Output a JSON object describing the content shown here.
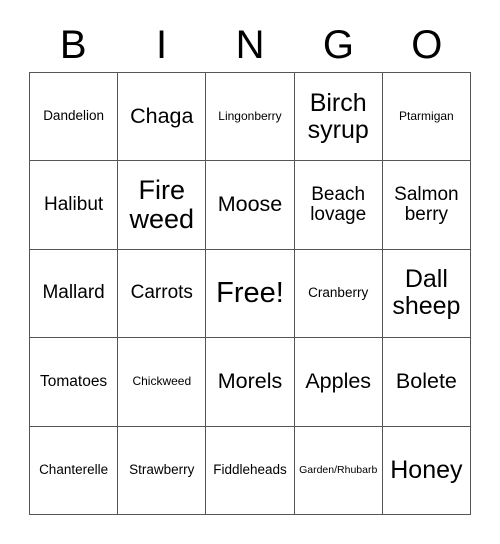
{
  "card": {
    "title": "BINGO",
    "header_letters": [
      "B",
      "I",
      "N",
      "G",
      "O"
    ],
    "grid_size": "5x5",
    "colors": {
      "background": "#ffffff",
      "text": "#000000",
      "grid_line": "#555555"
    },
    "rows": [
      [
        {
          "label": "Dandelion",
          "size": "sz-s"
        },
        {
          "label": "Chaga",
          "size": "sz-xl"
        },
        {
          "label": "Lingonberry",
          "size": "sz-xs"
        },
        {
          "label": "Birch syrup",
          "size": "sz-xxl"
        },
        {
          "label": "Ptarmigan",
          "size": "sz-xs"
        }
      ],
      [
        {
          "label": "Halibut",
          "size": "sz-l"
        },
        {
          "label": "Fire weed",
          "size": "sz-3xl"
        },
        {
          "label": "Moose",
          "size": "sz-xl"
        },
        {
          "label": "Beach lovage",
          "size": "sz-l"
        },
        {
          "label": "Salmon berry",
          "size": "sz-l"
        }
      ],
      [
        {
          "label": "Mallard",
          "size": "sz-l"
        },
        {
          "label": "Carrots",
          "size": "sz-l"
        },
        {
          "label": "Free!",
          "size": "sz-4xl"
        },
        {
          "label": "Cranberry",
          "size": "sz-s"
        },
        {
          "label": "Dall sheep",
          "size": "sz-xxl"
        }
      ],
      [
        {
          "label": "Tomatoes",
          "size": "sz-m"
        },
        {
          "label": "Chickweed",
          "size": "sz-xs"
        },
        {
          "label": "Morels",
          "size": "sz-xl"
        },
        {
          "label": "Apples",
          "size": "sz-xl"
        },
        {
          "label": "Bolete",
          "size": "sz-xl"
        }
      ],
      [
        {
          "label": "Chanterelle",
          "size": "sz-s"
        },
        {
          "label": "Strawberry",
          "size": "sz-s"
        },
        {
          "label": "Fiddleheads",
          "size": "sz-s"
        },
        {
          "label": "Garden/Rhubarb",
          "size": "sz-xxs"
        },
        {
          "label": "Honey",
          "size": "sz-xxl"
        }
      ]
    ]
  }
}
